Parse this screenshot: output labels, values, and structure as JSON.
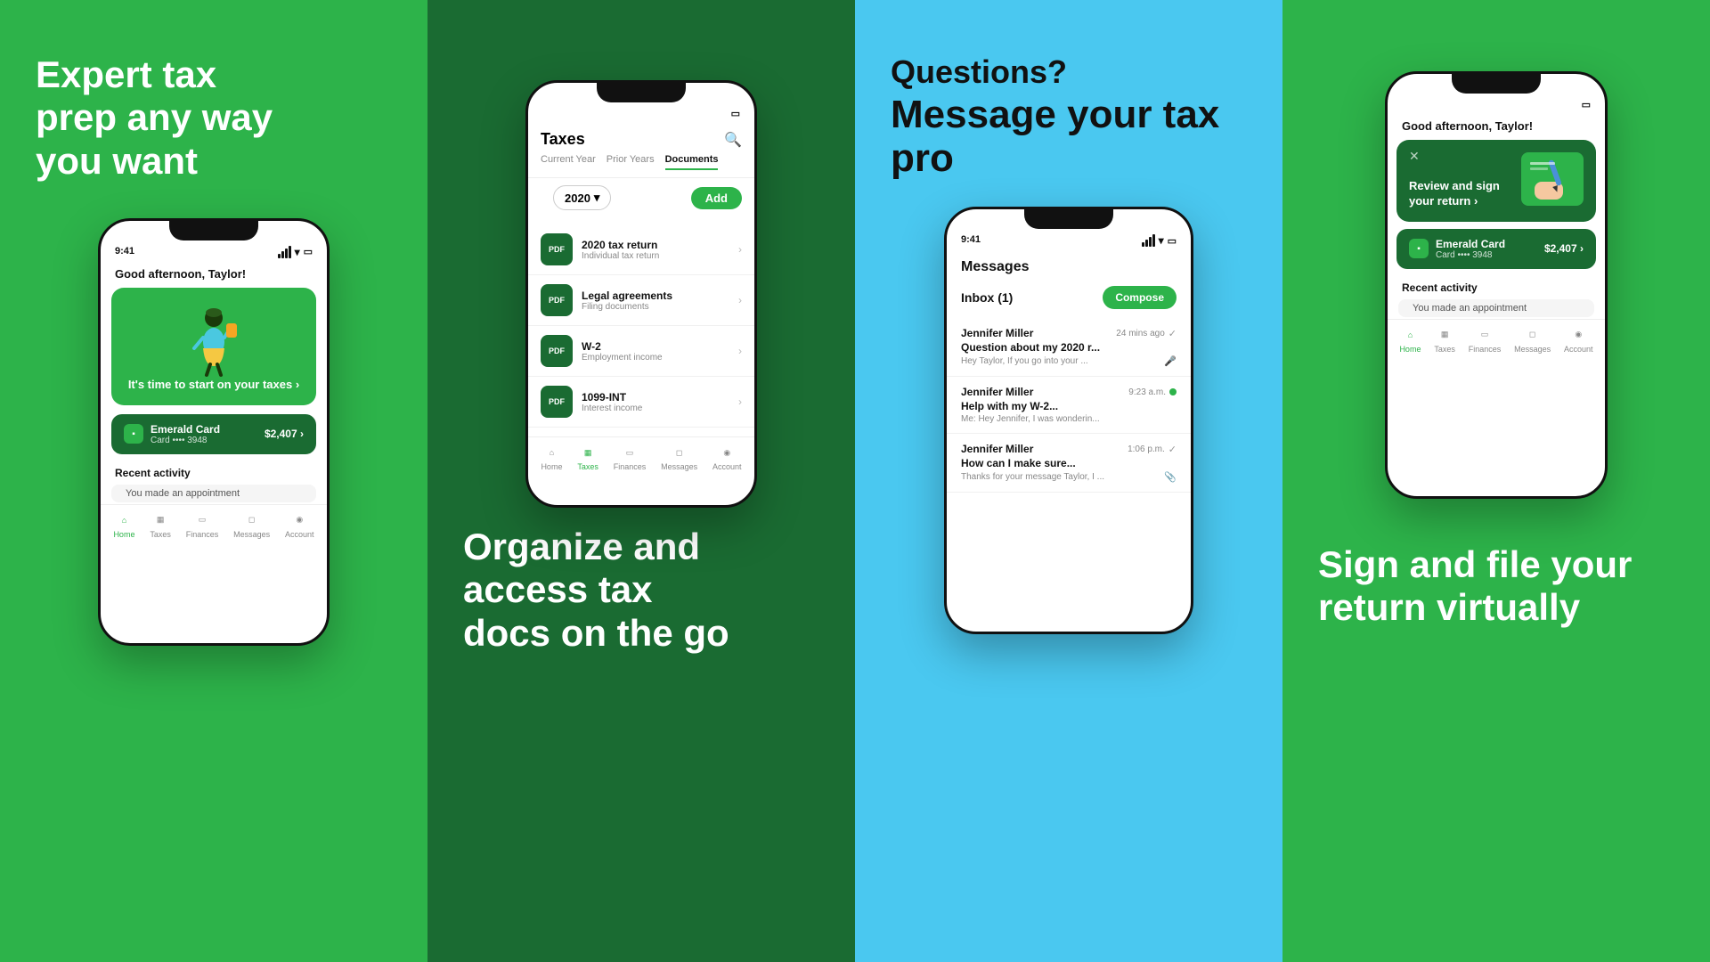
{
  "panel1": {
    "background": "#2db34a",
    "headline": "Expert tax prep any way you want",
    "phone": {
      "time": "9:41",
      "greeting": "Good afternoon, Taylor!",
      "card_cta": "It's time to start on your taxes ›",
      "emerald_card": {
        "name": "Emerald Card",
        "number": "Card •••• 3948",
        "amount": "$2,407 ›"
      },
      "recent_activity": "Recent activity",
      "recent_item": "You made an appointment"
    },
    "nav": [
      {
        "label": "Home",
        "active": true
      },
      {
        "label": "Taxes",
        "active": false
      },
      {
        "label": "Finances",
        "active": false
      },
      {
        "label": "Messages",
        "active": false
      },
      {
        "label": "Account",
        "active": false
      }
    ]
  },
  "panel2": {
    "background": "#1a6b32",
    "headline": "Organize and access tax docs on the go",
    "phone": {
      "title": "Taxes",
      "tabs": [
        "Current Year",
        "Prior Years",
        "Documents"
      ],
      "active_tab": "Documents",
      "year": "2020",
      "add_label": "Add",
      "documents": [
        {
          "name": "2020 tax return",
          "sub": "Individual tax return"
        },
        {
          "name": "Legal agreements",
          "sub": "Filing documents"
        },
        {
          "name": "W-2",
          "sub": "Employment income"
        },
        {
          "name": "1099-INT",
          "sub": "Interest income"
        }
      ]
    },
    "nav": [
      {
        "label": "Home",
        "active": false
      },
      {
        "label": "Taxes",
        "active": true
      },
      {
        "label": "Finances",
        "active": false
      },
      {
        "label": "Messages",
        "active": false
      },
      {
        "label": "Account",
        "active": false
      }
    ]
  },
  "panel3": {
    "background": "#4ac8f0",
    "headline_q": "Questions?",
    "headline": "Message your tax pro",
    "phone": {
      "time": "9:41",
      "title": "Messages",
      "inbox_label": "Inbox (1)",
      "compose_label": "Compose",
      "messages": [
        {
          "sender": "Jennifer Miller",
          "time": "24 mins ago",
          "subject": "Question about my 2020 r...",
          "preview": "Hey Taylor, If you go into your ...",
          "status": "check"
        },
        {
          "sender": "Jennifer Miller",
          "time": "9:23 a.m.",
          "subject": "Help with my W-2...",
          "preview": "Me: Hey Jennifer, I was wonderin...",
          "status": "online"
        },
        {
          "sender": "Jennifer Miller",
          "time": "1:06 p.m.",
          "subject": "How can I make sure...",
          "preview": "Thanks for your message Taylor, I ...",
          "status": "attach"
        }
      ]
    }
  },
  "panel4": {
    "background": "#2db34a",
    "headline": "Sign and file your return virtually",
    "phone": {
      "greeting": "Good afternoon, Taylor!",
      "review_card": {
        "text": "Review and sign your return ›"
      },
      "emerald_card": {
        "name": "Emerald Card",
        "number": "Card •••• 3948",
        "amount": "$2,407 ›"
      },
      "recent_activity": "Recent activity",
      "recent_item": "You made an appointment"
    },
    "nav": [
      {
        "label": "Home",
        "active": true
      },
      {
        "label": "Taxes",
        "active": false
      },
      {
        "label": "Finances",
        "active": false
      },
      {
        "label": "Messages",
        "active": false
      },
      {
        "label": "Account",
        "active": false
      }
    ]
  }
}
